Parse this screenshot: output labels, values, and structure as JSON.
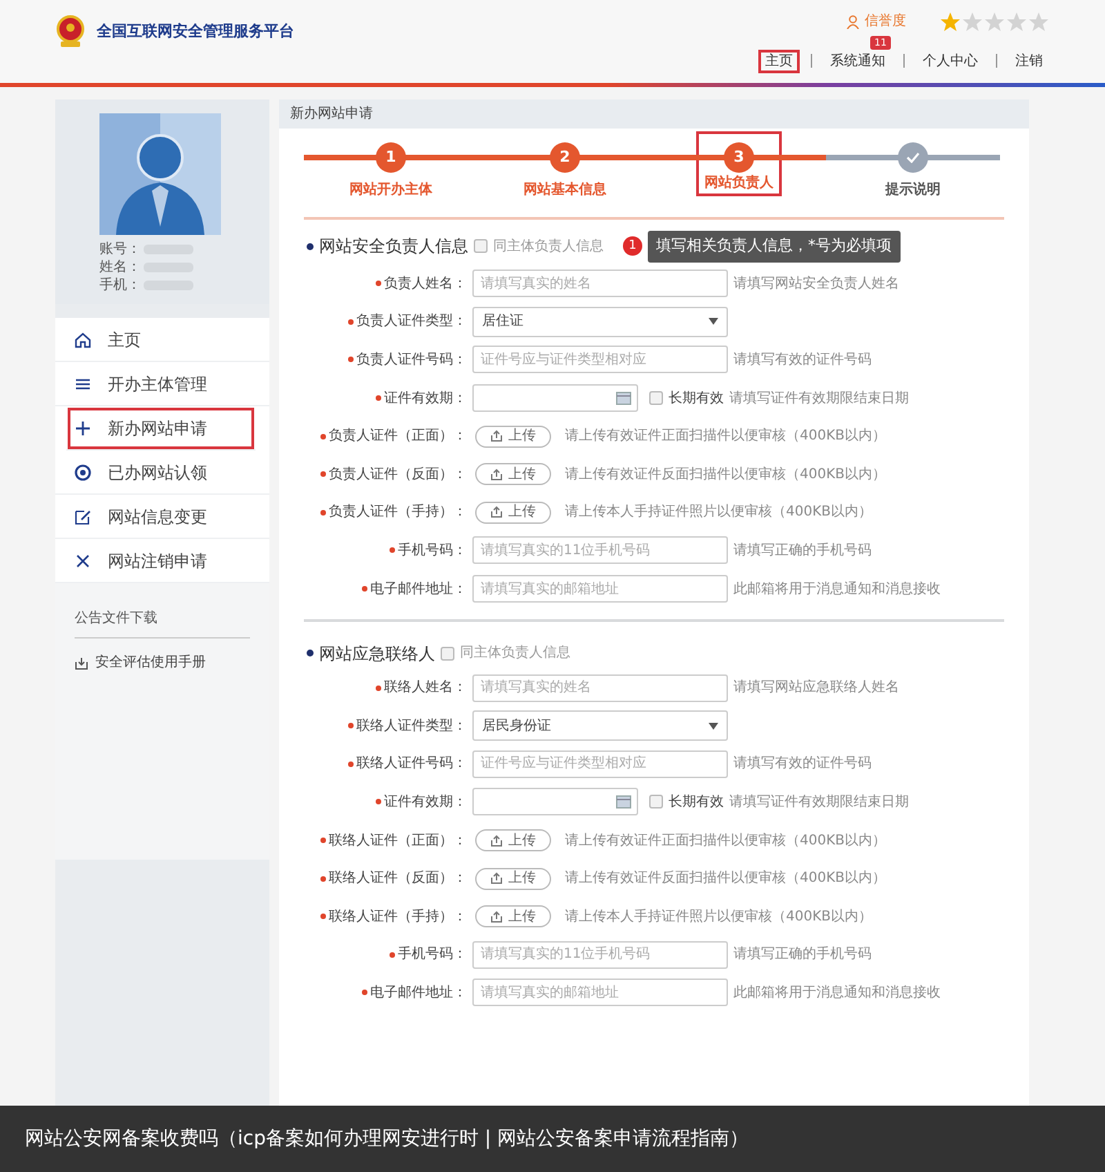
{
  "header": {
    "site_title": "全国互联网安全管理服务平台",
    "credit_label": "信誉度",
    "stars": 1,
    "nav": [
      {
        "label": "主页",
        "annotated": true
      },
      {
        "label": "系统通知",
        "badge": "11",
        "annotated": false
      },
      {
        "label": "个人中心",
        "annotated": false
      },
      {
        "label": "注销",
        "annotated": false
      }
    ]
  },
  "sidebar": {
    "profile_fields": [
      {
        "label": "账号："
      },
      {
        "label": "姓名："
      },
      {
        "label": "手机："
      }
    ],
    "menu": [
      {
        "kind": "home",
        "label": "主页",
        "annotated": false
      },
      {
        "kind": "list",
        "label": "开办主体管理",
        "annotated": false
      },
      {
        "kind": "plus",
        "label": "新办网站申请",
        "annotated": true
      },
      {
        "kind": "at",
        "label": "已办网站认领",
        "annotated": false
      },
      {
        "kind": "edit",
        "label": "网站信息变更",
        "annotated": false
      },
      {
        "kind": "cross",
        "label": "网站注销申请",
        "annotated": false
      }
    ],
    "downloads_title": "公告文件下载",
    "downloads": [
      {
        "label": "安全评估使用手册"
      }
    ]
  },
  "panel": {
    "title": "新办网站申请",
    "steps": [
      {
        "number": "1",
        "label": "网站开办主体",
        "reached": true,
        "annotated": false
      },
      {
        "number": "2",
        "label": "网站基本信息",
        "reached": true,
        "annotated": false
      },
      {
        "number": "3",
        "label": "网站负责人",
        "reached": true,
        "annotated": true
      },
      {
        "label": "提示说明",
        "reached": false,
        "annotated": false
      }
    ],
    "sections": [
      {
        "title": "网站安全负责人信息",
        "same_as": {
          "label": "同主体负责人信息",
          "checked": false
        },
        "tip": {
          "number": "1",
          "text": "填写相关负责人信息，*号为必填项"
        },
        "rows": [
          {
            "kind": "text",
            "label": "负责人姓名：",
            "required": true,
            "placeholder": "请填写真实的姓名",
            "hint": "请填写网站安全负责人姓名"
          },
          {
            "kind": "select",
            "label": "负责人证件类型：",
            "required": true,
            "value": "居住证"
          },
          {
            "kind": "text",
            "label": "负责人证件号码：",
            "required": true,
            "placeholder": "证件号应与证件类型相对应",
            "hint": "请填写有效的证件号码"
          },
          {
            "kind": "date",
            "label": "证件有效期：",
            "required": true,
            "long_term": {
              "label": "长期有效",
              "checked": false
            },
            "hint": "请填写证件有效期限结束日期"
          },
          {
            "kind": "upload",
            "label": "负责人证件（正面）：",
            "required": true,
            "button": "上传",
            "hint": "请上传有效证件正面扫描件以便审核（400KB以内）"
          },
          {
            "kind": "upload",
            "label": "负责人证件（反面）：",
            "required": true,
            "button": "上传",
            "hint": "请上传有效证件反面扫描件以便审核（400KB以内）"
          },
          {
            "kind": "upload",
            "label": "负责人证件（手持）：",
            "required": true,
            "button": "上传",
            "hint": "请上传本人手持证件照片以便审核（400KB以内）"
          },
          {
            "kind": "text",
            "label": "手机号码：",
            "required": true,
            "placeholder": "请填写真实的11位手机号码",
            "hint": "请填写正确的手机号码"
          },
          {
            "kind": "text",
            "label": "电子邮件地址：",
            "required": true,
            "placeholder": "请填写真实的邮箱地址",
            "hint": "此邮箱将用于消息通知和消息接收"
          }
        ]
      },
      {
        "title": "网站应急联络人",
        "same_as": {
          "label": "同主体负责人信息",
          "checked": false
        },
        "rows": [
          {
            "kind": "text",
            "label": "联络人姓名：",
            "required": true,
            "placeholder": "请填写真实的姓名",
            "hint": "请填写网站应急联络人姓名"
          },
          {
            "kind": "select",
            "label": "联络人证件类型：",
            "required": true,
            "value": "居民身份证"
          },
          {
            "kind": "text",
            "label": "联络人证件号码：",
            "required": true,
            "placeholder": "证件号应与证件类型相对应",
            "hint": "请填写有效的证件号码"
          },
          {
            "kind": "date",
            "label": "证件有效期：",
            "required": true,
            "long_term": {
              "label": "长期有效",
              "checked": false
            },
            "hint": "请填写证件有效期限结束日期"
          },
          {
            "kind": "upload",
            "label": "联络人证件（正面）：",
            "required": true,
            "button": "上传",
            "hint": "请上传有效证件正面扫描件以便审核（400KB以内）"
          },
          {
            "kind": "upload",
            "label": "联络人证件（反面）：",
            "required": true,
            "button": "上传",
            "hint": "请上传有效证件反面扫描件以便审核（400KB以内）"
          },
          {
            "kind": "upload",
            "label": "联络人证件（手持）：",
            "required": true,
            "button": "上传",
            "hint": "请上传本人手持证件照片以便审核（400KB以内）"
          },
          {
            "kind": "text",
            "label": "手机号码：",
            "required": true,
            "placeholder": "请填写真实的11位手机号码",
            "hint": "请填写正确的手机号码"
          },
          {
            "kind": "text",
            "label": "电子邮件地址：",
            "required": true,
            "placeholder": "请填写真实的邮箱地址",
            "hint": "此邮箱将用于消息通知和消息接收"
          }
        ]
      }
    ]
  },
  "caption": "网站公安网备案收费吗（icp备案如何办理网安进行时 | 网站公安备案申请流程指南）"
}
